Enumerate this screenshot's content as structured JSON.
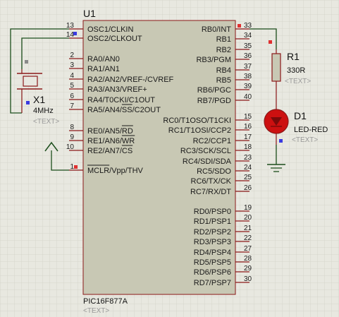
{
  "u1": {
    "ref": "U1",
    "part": "PIC16F877A",
    "text_placeholder": "<TEXT>",
    "left_pins": [
      {
        "num": "13",
        "label": "OSC1/CLKIN",
        "bar": ""
      },
      {
        "num": "14",
        "label": "OSC2/CLKOUT",
        "bar": ""
      },
      {
        "num": "2",
        "label": "RA0/AN0",
        "bar": ""
      },
      {
        "num": "3",
        "label": "RA1/AN1",
        "bar": ""
      },
      {
        "num": "4",
        "label": "RA2/AN2/VREF-/CVREF",
        "bar": ""
      },
      {
        "num": "5",
        "label": "RA3/AN3/VREF+",
        "bar": ""
      },
      {
        "num": "6",
        "label": "RA4/T0CKI/C1OUT",
        "bar": ""
      },
      {
        "num": "7",
        "label": "RA5/AN4/SS/C2OUT",
        "bar": "SS"
      },
      {
        "num": "8",
        "label": "RE0/AN5/RD",
        "bar": "RD"
      },
      {
        "num": "9",
        "label": "RE1/AN6/WR",
        "bar": "WR"
      },
      {
        "num": "10",
        "label": "RE2/AN7/CS",
        "bar": "CS"
      },
      {
        "num": "1",
        "label": "MCLR/Vpp/THV",
        "bar": "MCLR"
      }
    ],
    "right_pins": [
      {
        "num": "33",
        "label": "RB0/INT"
      },
      {
        "num": "34",
        "label": "RB1"
      },
      {
        "num": "35",
        "label": "RB2"
      },
      {
        "num": "36",
        "label": "RB3/PGM"
      },
      {
        "num": "37",
        "label": "RB4"
      },
      {
        "num": "38",
        "label": "RB5"
      },
      {
        "num": "39",
        "label": "RB6/PGC"
      },
      {
        "num": "40",
        "label": "RB7/PGD"
      },
      {
        "num": "15",
        "label": "RC0/T1OSO/T1CKI"
      },
      {
        "num": "16",
        "label": "RC1/T1OSI/CCP2"
      },
      {
        "num": "17",
        "label": "RC2/CCP1"
      },
      {
        "num": "18",
        "label": "RC3/SCK/SCL"
      },
      {
        "num": "23",
        "label": "RC4/SDI/SDA"
      },
      {
        "num": "24",
        "label": "RC5/SDO"
      },
      {
        "num": "25",
        "label": "RC6/TX/CK"
      },
      {
        "num": "26",
        "label": "RC7/RX/DT"
      },
      {
        "num": "19",
        "label": "RD0/PSP0"
      },
      {
        "num": "20",
        "label": "RD1/PSP1"
      },
      {
        "num": "21",
        "label": "RD2/PSP2"
      },
      {
        "num": "22",
        "label": "RD3/PSP3"
      },
      {
        "num": "27",
        "label": "RD4/PSP4"
      },
      {
        "num": "28",
        "label": "RD5/PSP5"
      },
      {
        "num": "29",
        "label": "RD6/PSP6"
      },
      {
        "num": "30",
        "label": "RD7/PSP7"
      }
    ]
  },
  "x1": {
    "ref": "X1",
    "value": "4MHz",
    "text_placeholder": "<TEXT>"
  },
  "r1": {
    "ref": "R1",
    "value": "330R",
    "text_placeholder": "<TEXT>"
  },
  "d1": {
    "ref": "D1",
    "value": "LED-RED",
    "text_placeholder": "<TEXT>"
  },
  "colors": {
    "background": "#e8e8e0",
    "grid": "#d6d6cc",
    "chip_body": "#c8c8b4",
    "outline": "#8a1818",
    "wire": "#1c4e1c",
    "led": "#cc1010",
    "pin_marker_red": "#e03030",
    "pin_marker_blue": "#3a3ae0",
    "pin_marker_gray": "#8a8a8a"
  }
}
